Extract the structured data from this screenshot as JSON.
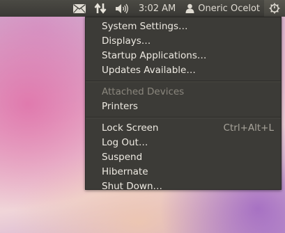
{
  "panel": {
    "clock": "3:02 AM",
    "user_name": "Oneric Ocelot"
  },
  "menu": {
    "group1": [
      {
        "label": "System Settings…"
      },
      {
        "label": "Displays…"
      },
      {
        "label": "Startup Applications…"
      },
      {
        "label": "Updates Available…"
      }
    ],
    "group2": [
      {
        "label": "Attached Devices",
        "disabled": true
      },
      {
        "label": "Printers"
      }
    ],
    "group3": [
      {
        "label": "Lock Screen",
        "shortcut": "Ctrl+Alt+L"
      },
      {
        "label": "Log Out…"
      },
      {
        "label": "Suspend"
      },
      {
        "label": "Hibernate"
      },
      {
        "label": "Shut Down…"
      }
    ]
  },
  "icons": {
    "mail": "envelope-icon",
    "network": "network-arrows-icon",
    "volume": "speaker-icon",
    "user": "person-icon",
    "session": "power-gear-icon"
  }
}
